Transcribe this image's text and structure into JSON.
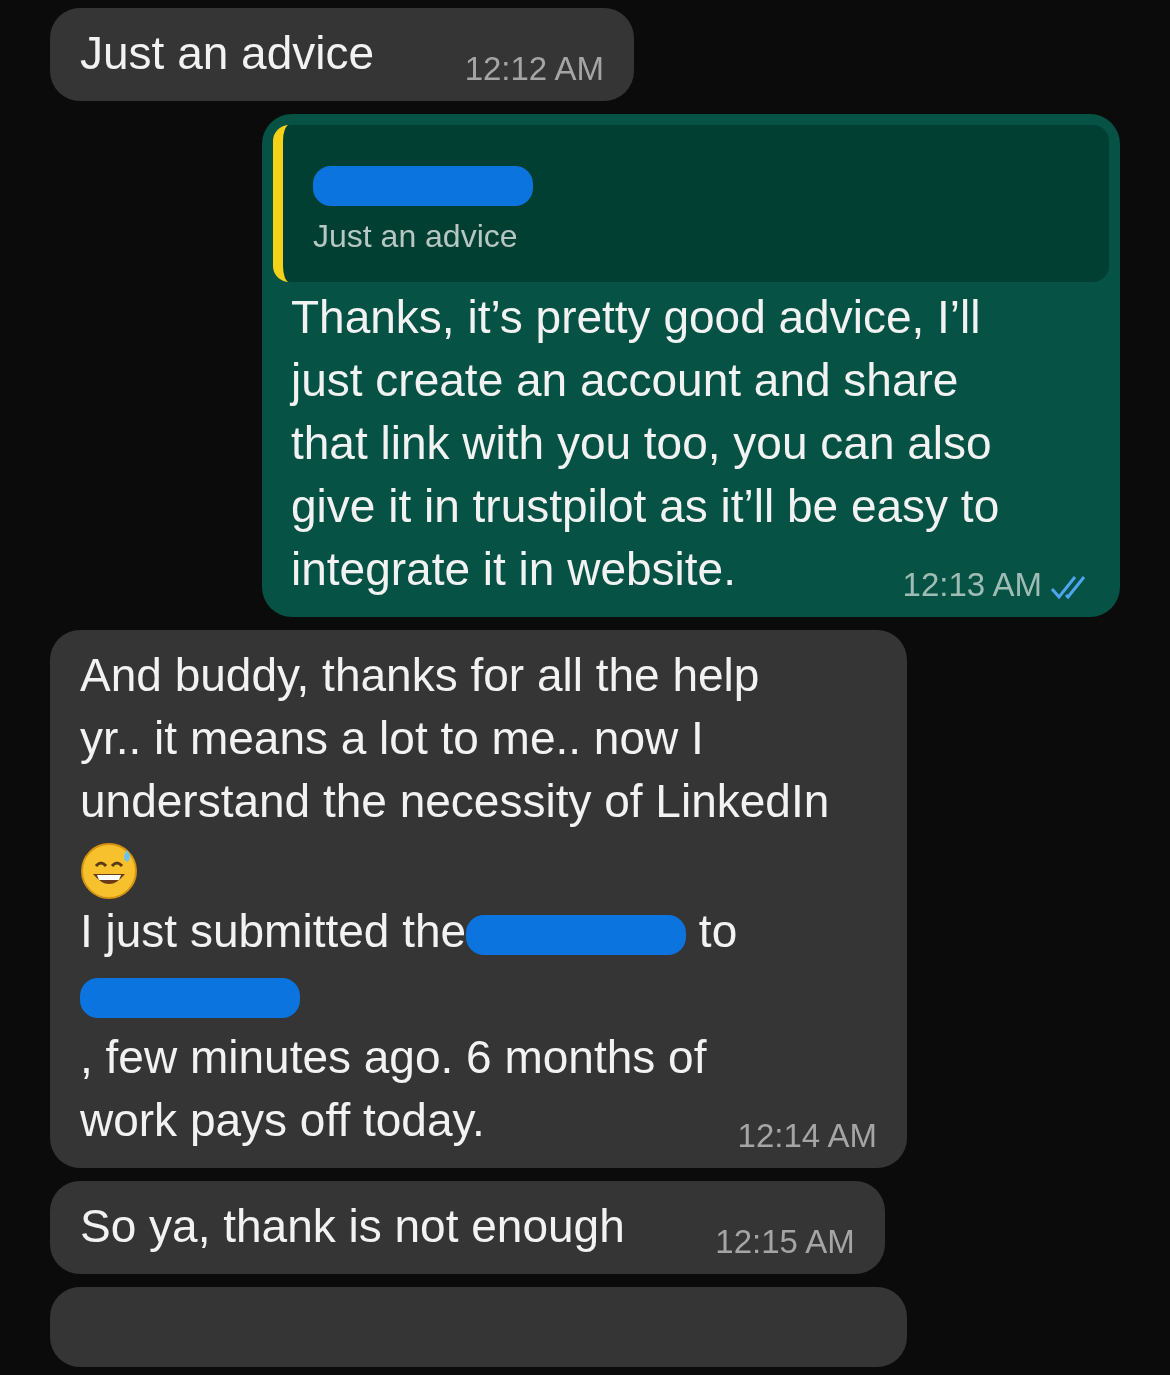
{
  "messages": [
    {
      "kind": "incoming",
      "parts": [
        {
          "kind": "text",
          "text": "Just an advice"
        }
      ],
      "time": "12:12 AM"
    },
    {
      "kind": "outgoing",
      "quote": {
        "author": [
          {
            "kind": "redacted"
          }
        ],
        "text": "Just an advice"
      },
      "parts": [
        {
          "kind": "text",
          "text": "Thanks, it’s pretty good advice, I’ll"
        },
        {
          "kind": "break"
        },
        {
          "kind": "text",
          "text": "just create an account and share"
        },
        {
          "kind": "break"
        },
        {
          "kind": "text",
          "text": "that link with you too, you can also"
        },
        {
          "kind": "break"
        },
        {
          "kind": "text",
          "text": "give it in trustpilot as it’ll be easy to"
        },
        {
          "kind": "break"
        },
        {
          "kind": "text",
          "text": "integrate it in website."
        }
      ],
      "time": "12:13 AM",
      "read": true
    },
    {
      "kind": "incoming",
      "parts": [
        {
          "kind": "text",
          "text": "And buddy, thanks for all the help"
        },
        {
          "kind": "break"
        },
        {
          "kind": "text",
          "text": "yr.. it means a lot to me.. now I"
        },
        {
          "kind": "break"
        },
        {
          "kind": "text",
          "text": "understand the necessity of LinkedIn"
        },
        {
          "kind": "break"
        },
        {
          "kind": "emoji"
        },
        {
          "kind": "break"
        },
        {
          "kind": "text",
          "text": "I just submitted the"
        },
        {
          "kind": "redacted"
        },
        {
          "kind": "text",
          "text": " to"
        },
        {
          "kind": "break"
        },
        {
          "kind": "redacted"
        },
        {
          "kind": "text",
          "text": ", few minutes ago. 6 months of"
        },
        {
          "kind": "break"
        },
        {
          "kind": "text",
          "text": "work pays off today."
        }
      ],
      "time": "12:14 AM"
    },
    {
      "kind": "incoming",
      "parts": [
        {
          "kind": "text",
          "text": "So ya, thank is not enough"
        }
      ],
      "time": "12:15 AM"
    },
    {
      "kind": "incoming",
      "cut_off": true
    }
  ]
}
